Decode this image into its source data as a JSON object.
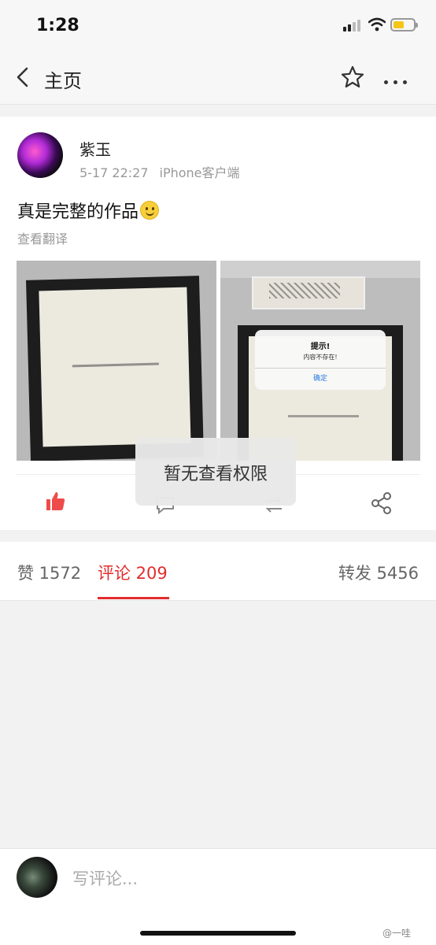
{
  "status_bar": {
    "time": "1:28"
  },
  "nav": {
    "title": "主页"
  },
  "post": {
    "author": "紫玉",
    "time": "5-17 22:27",
    "source": "iPhone客户端",
    "text": "真是完整的作品",
    "translate_label": "查看翻译",
    "photo2_screen": {
      "dialog_title": "提示!",
      "dialog_message": "内容不存在!",
      "dialog_button": "确定"
    }
  },
  "toast": {
    "text": "暂无查看权限"
  },
  "tabs": {
    "likes": "赞 1572",
    "comments": "评论 209",
    "reposts": "转发 5456"
  },
  "comment_bar": {
    "placeholder": "写评论..."
  },
  "watermark": "@一哇",
  "colors": {
    "accent_red": "#e22d2d",
    "like_red": "#ef4b4b"
  },
  "icons": [
    "back-icon",
    "star-icon",
    "more-icon",
    "like-icon",
    "comment-icon",
    "repost-icon",
    "share-icon"
  ]
}
